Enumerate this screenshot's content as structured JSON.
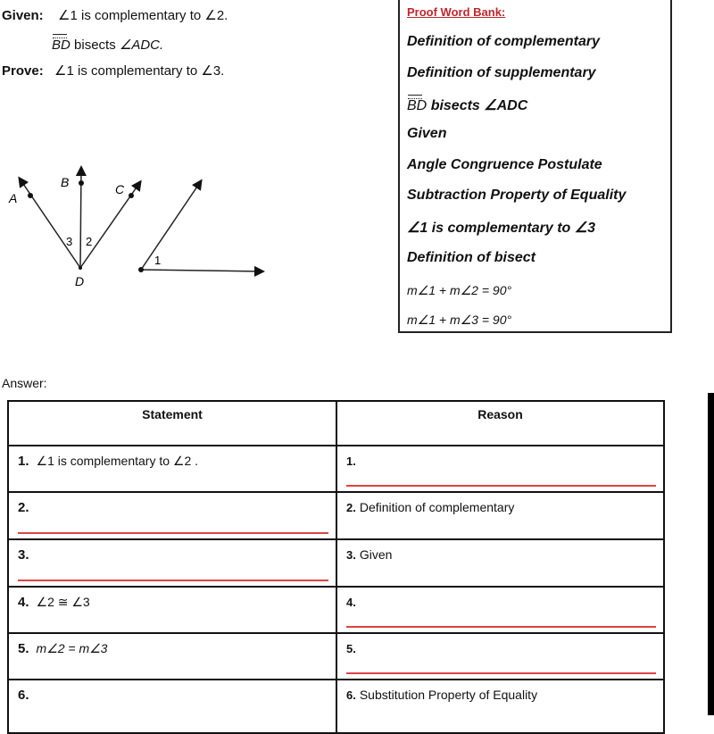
{
  "given": {
    "given_label": "Given:",
    "given_line1_angle_a": "∠1",
    "given_line1_text": "is complementary to",
    "given_line1_angle_b": "∠2.",
    "given_line2_ray": "BD",
    "given_line2_text": "bisects",
    "given_line2_angle": "∠ADC.",
    "prove_label": "Prove:",
    "prove_angle_a": "∠1",
    "prove_text": "is complementary to",
    "prove_angle_b": "∠3."
  },
  "diagram": {
    "labels": {
      "A": "A",
      "B": "B",
      "C": "C",
      "D": "D",
      "angle3": "3",
      "angle2": "2",
      "angle1": "1"
    }
  },
  "word_bank": {
    "title": "Proof Word Bank:",
    "title_color": "#c0272d",
    "items": [
      "Definition of complementary",
      "Definition of supplementary",
      "bisects ∠ADC",
      "Given",
      "Angle Congruence Postulate",
      "Subtraction Property of Equality",
      "∠1 is complementary to ∠3",
      "Definition of bisect",
      "m∠1 + m∠2 = 90°",
      "m∠1 + m∠3 = 90°"
    ],
    "ray_label": "BD"
  },
  "answer": {
    "label": "Answer:",
    "headers": {
      "statement": "Statement",
      "reason": "Reason"
    },
    "blank_line_color": "#dd4444",
    "rows": [
      {
        "num": "1.",
        "statement": "∠1 is complementary to ∠2 .",
        "reason_num": "1.",
        "reason": ""
      },
      {
        "num": "2.",
        "statement": "",
        "reason_num": "2.",
        "reason": "Definition of complementary"
      },
      {
        "num": "3.",
        "statement": "",
        "reason_num": "3.",
        "reason": "Given"
      },
      {
        "num": "4.",
        "statement": "∠2 ≅ ∠3",
        "reason_num": "4.",
        "reason": ""
      },
      {
        "num": "5.",
        "statement": "m∠2 = m∠3",
        "reason_num": "5.",
        "reason": ""
      },
      {
        "num": "6.",
        "statement": "",
        "reason_num": "6.",
        "reason": "Substitution Property of Equality"
      }
    ]
  }
}
